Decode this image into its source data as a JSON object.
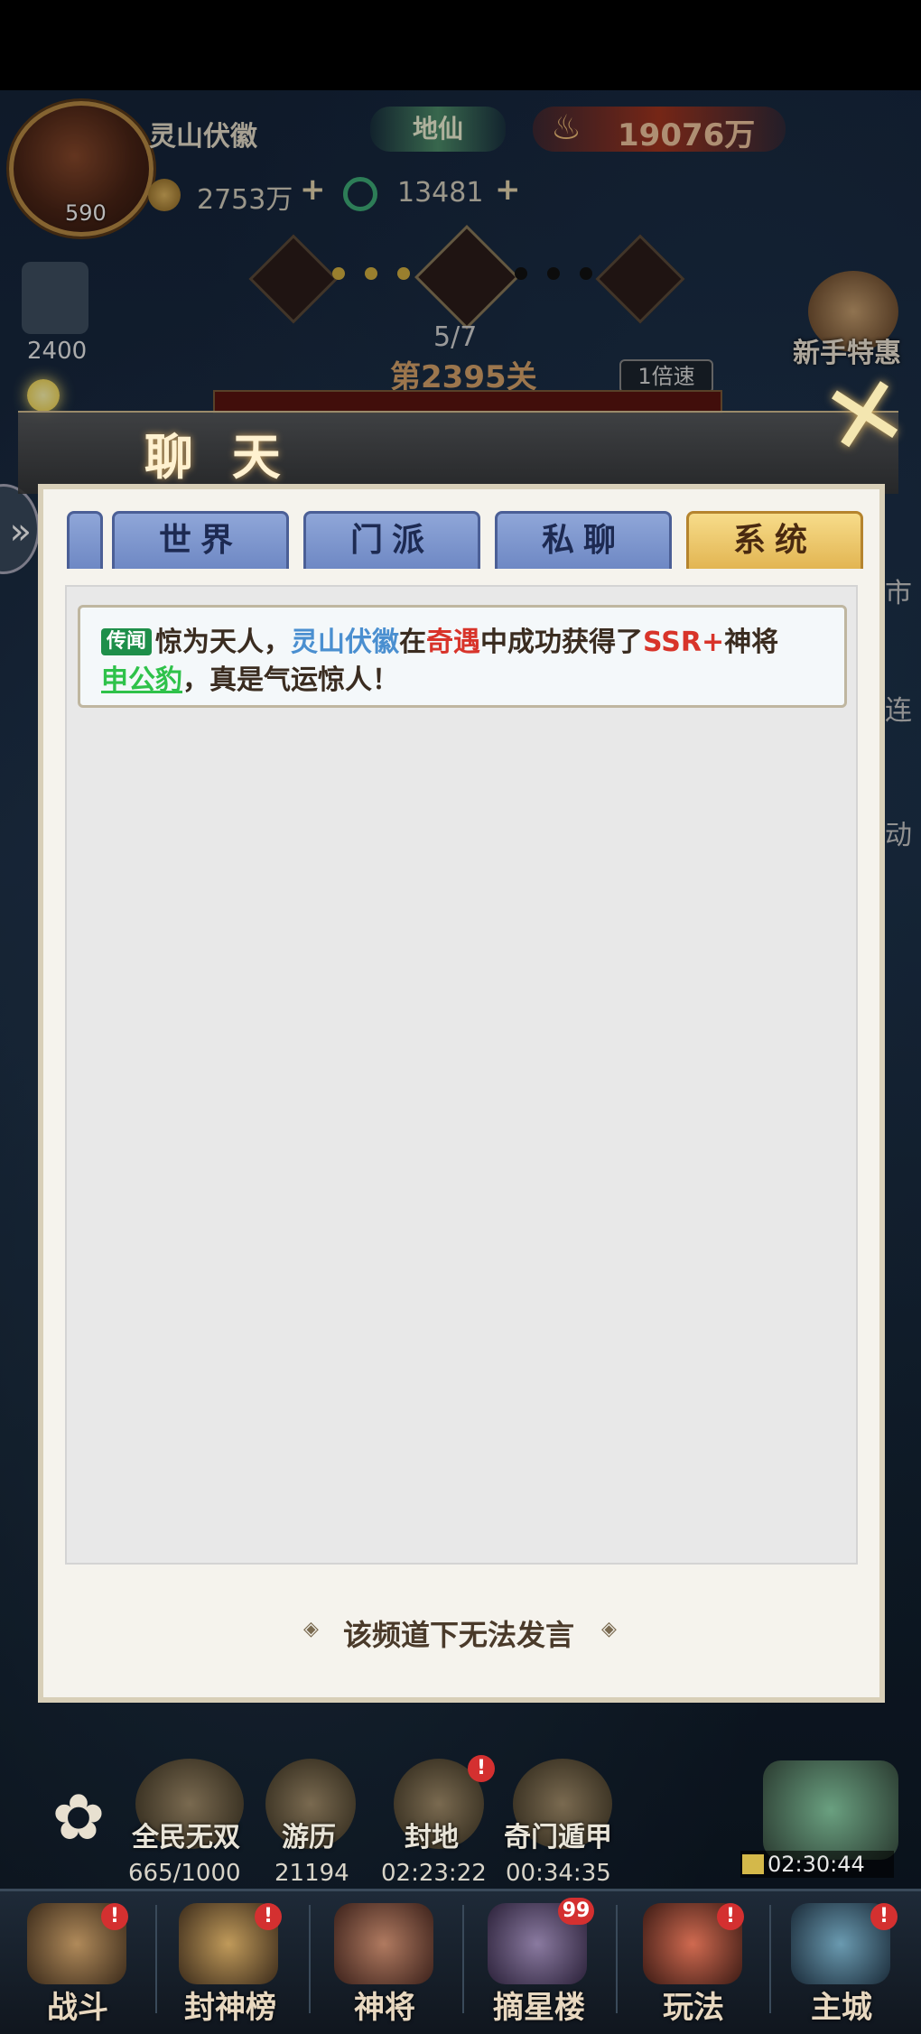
{
  "player": {
    "name": "灵山伏徽",
    "level": "590",
    "rank": "地仙",
    "power": "19076万"
  },
  "resources": {
    "coins": "2753万",
    "jade": "13481",
    "plus": "+"
  },
  "stage": {
    "progress": "5/7",
    "level": "第2395关",
    "speed": "1倍速"
  },
  "left_widget": {
    "value": "2400"
  },
  "right_widget": {
    "label": "新手特惠"
  },
  "side_labels": {
    "market": "市",
    "connect": "连",
    "event": "动"
  },
  "chat": {
    "title": "聊 天",
    "close_icon": "✕",
    "tabs": [
      {
        "label": "世界",
        "active": false
      },
      {
        "label": "门派",
        "active": false
      },
      {
        "label": "私聊",
        "active": false
      },
      {
        "label": "系统",
        "active": true
      }
    ],
    "messages": [
      {
        "tag": "传闻",
        "seg1": "惊为天人，",
        "player": "灵山伏徽",
        "seg2": "在",
        "source": "奇遇",
        "seg3": "中成功获得了",
        "rarity": "SSR+",
        "seg4": "神将",
        "hero": "申公豹",
        "seg5": "，真是气运惊人！"
      }
    ],
    "no_speak": "该频道下无法发言"
  },
  "functions": [
    {
      "label": "全民无双",
      "value": "665/1000",
      "badge": false
    },
    {
      "label": "游历",
      "value": "21194",
      "badge": false
    },
    {
      "label": "封地",
      "value": "02:23:22",
      "badge": true
    },
    {
      "label": "奇门遁甲",
      "value": "00:34:35",
      "badge": false
    }
  ],
  "chest": {
    "timer": "02:30:44"
  },
  "nav": [
    {
      "label": "战斗",
      "badge": "!"
    },
    {
      "label": "封神榜",
      "badge": "!"
    },
    {
      "label": "神将",
      "badge": ""
    },
    {
      "label": "摘星楼",
      "badge": "99"
    },
    {
      "label": "玩法",
      "badge": "!"
    },
    {
      "label": "主城",
      "badge": "!"
    }
  ],
  "colors": {
    "accent_gold": "#e2b552",
    "tab_blue": "#8fa6d8",
    "tag_green": "#1e8f4a",
    "highlight_red": "#d8342a",
    "player_blue": "#4a8fd0",
    "hero_green": "#2fc24a"
  }
}
